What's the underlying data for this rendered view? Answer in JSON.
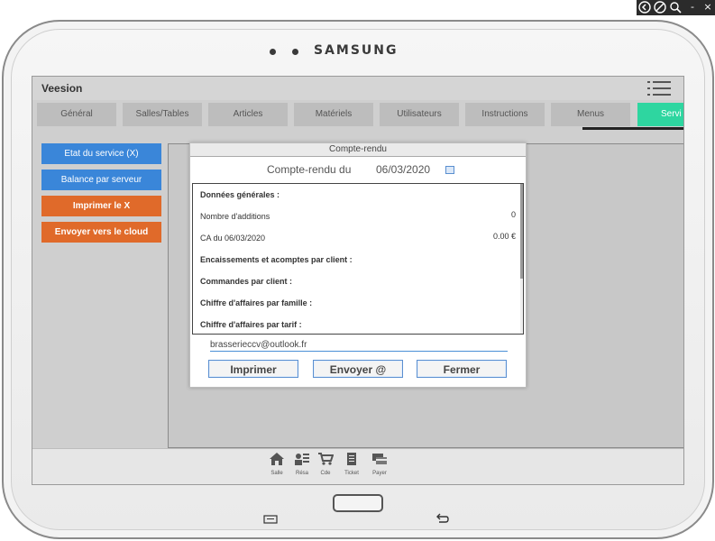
{
  "window": {
    "icons": [
      "back-icon",
      "rotate-icon",
      "zoom-icon",
      "minimize-icon",
      "close-icon"
    ],
    "minimize_label": "-",
    "close_label": "×"
  },
  "device": {
    "brand": "SAMSUNG"
  },
  "app": {
    "title": "Veesion",
    "accent_color": "#2ed6a0"
  },
  "tabs": [
    {
      "label": "Général"
    },
    {
      "label": "Salles/Tables"
    },
    {
      "label": "Articles"
    },
    {
      "label": "Matériels"
    },
    {
      "label": "Utilisateurs"
    },
    {
      "label": "Instructions"
    },
    {
      "label": "Menus"
    },
    {
      "label": "Servi",
      "active": true
    }
  ],
  "sidebar": {
    "buttons": [
      {
        "label": "Etat du service (X)",
        "color": "#3a86d9"
      },
      {
        "label": "Balance par serveur",
        "color": "#3a86d9"
      },
      {
        "label": "Imprimer le X",
        "color": "#e06a2a"
      },
      {
        "label": "Envoyer vers le cloud",
        "color": "#e06a2a"
      }
    ]
  },
  "dialog": {
    "title": "Compte-rendu",
    "subtitle": "Compte-rendu du",
    "date": "06/03/2020",
    "report": [
      {
        "label": "Données générales :",
        "bold": true
      },
      {
        "label": "Nombre d'additions",
        "value": "0"
      },
      {
        "label": "CA du 06/03/2020",
        "value": "0.00 €"
      },
      {
        "label": "Encaissements et acomptes par client :",
        "bold": true
      },
      {
        "label": "Commandes par client :",
        "bold": true
      },
      {
        "label": "Chiffre d'affaires par famille :",
        "bold": true
      },
      {
        "label": "Chiffre d'affaires par tarif :",
        "bold": true
      }
    ],
    "email": "brasserieccv@outlook.fr",
    "buttons": {
      "print": "Imprimer",
      "send": "Envoyer @",
      "close": "Fermer"
    }
  },
  "bottom_nav": [
    {
      "label": "Salle",
      "icon": "home-icon"
    },
    {
      "label": "Résa",
      "icon": "reservation-icon"
    },
    {
      "label": "Cde",
      "icon": "cart-icon"
    },
    {
      "label": "Ticket",
      "icon": "ticket-icon"
    },
    {
      "label": "Payer",
      "icon": "payment-icon"
    }
  ],
  "hardware_keys": [
    "menu-key-icon",
    "home-key",
    "back-key-icon"
  ]
}
